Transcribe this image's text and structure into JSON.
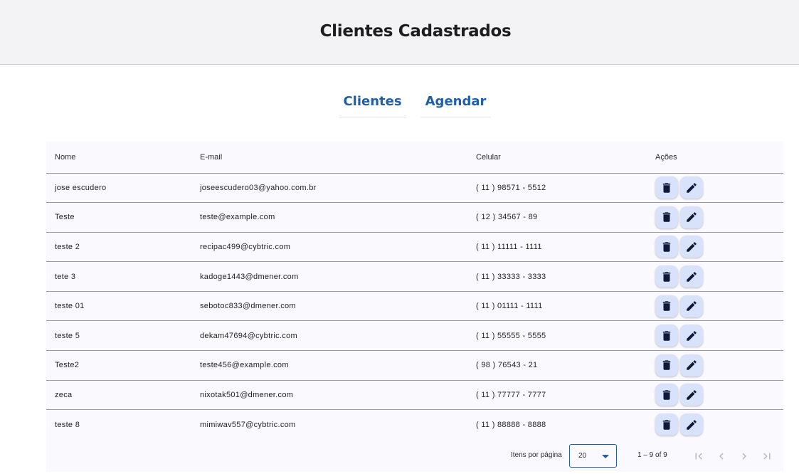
{
  "header": {
    "title": "Clientes Cadastrados"
  },
  "nav": {
    "items": [
      {
        "label": "Clientes"
      },
      {
        "label": "Agendar"
      }
    ]
  },
  "table": {
    "columns": [
      "Nome",
      "E-mail",
      "Celular",
      "Ações"
    ],
    "rows": [
      {
        "nome": "jose escudero",
        "email": "joseescudero03@yahoo.com.br",
        "celular": "( 11 ) 98571 - 5512"
      },
      {
        "nome": "Teste",
        "email": "teste@example.com",
        "celular": "( 12 ) 34567 - 89"
      },
      {
        "nome": "teste 2",
        "email": "recipac499@cybtric.com",
        "celular": "( 11 ) 11111 - 1111"
      },
      {
        "nome": "tete 3",
        "email": "kadoge1443@dmener.com",
        "celular": "( 11 ) 33333 - 3333"
      },
      {
        "nome": "teste 01",
        "email": "sebotoc833@dmener.com",
        "celular": "( 11 ) 01111 - 1111"
      },
      {
        "nome": "teste 5",
        "email": "dekam47694@cybtric.com",
        "celular": "( 11 ) 55555 - 5555"
      },
      {
        "nome": "Teste2",
        "email": "teste456@example.com",
        "celular": "( 98 ) 76543 - 21"
      },
      {
        "nome": "zeca",
        "email": "nixotak501@dmener.com",
        "celular": "( 11 ) 77777 - 7777"
      },
      {
        "nome": "teste 8",
        "email": "mimiwav557@cybtric.com",
        "celular": "( 11 ) 88888 - 8888"
      }
    ],
    "action_icons": [
      "delete-icon",
      "edit-icon"
    ]
  },
  "paginator": {
    "items_per_page_label": "Itens por página",
    "page_size": "20",
    "range_label": "1 – 9 of 9",
    "icons": [
      "first-page-icon",
      "previous-page-icon",
      "next-page-icon",
      "last-page-icon"
    ]
  },
  "colors": {
    "accent": "#1f5fa8",
    "header_bg": "#f3f3f5",
    "action_button_bg": "#d8e2fb",
    "icon_color": "#10183a"
  }
}
